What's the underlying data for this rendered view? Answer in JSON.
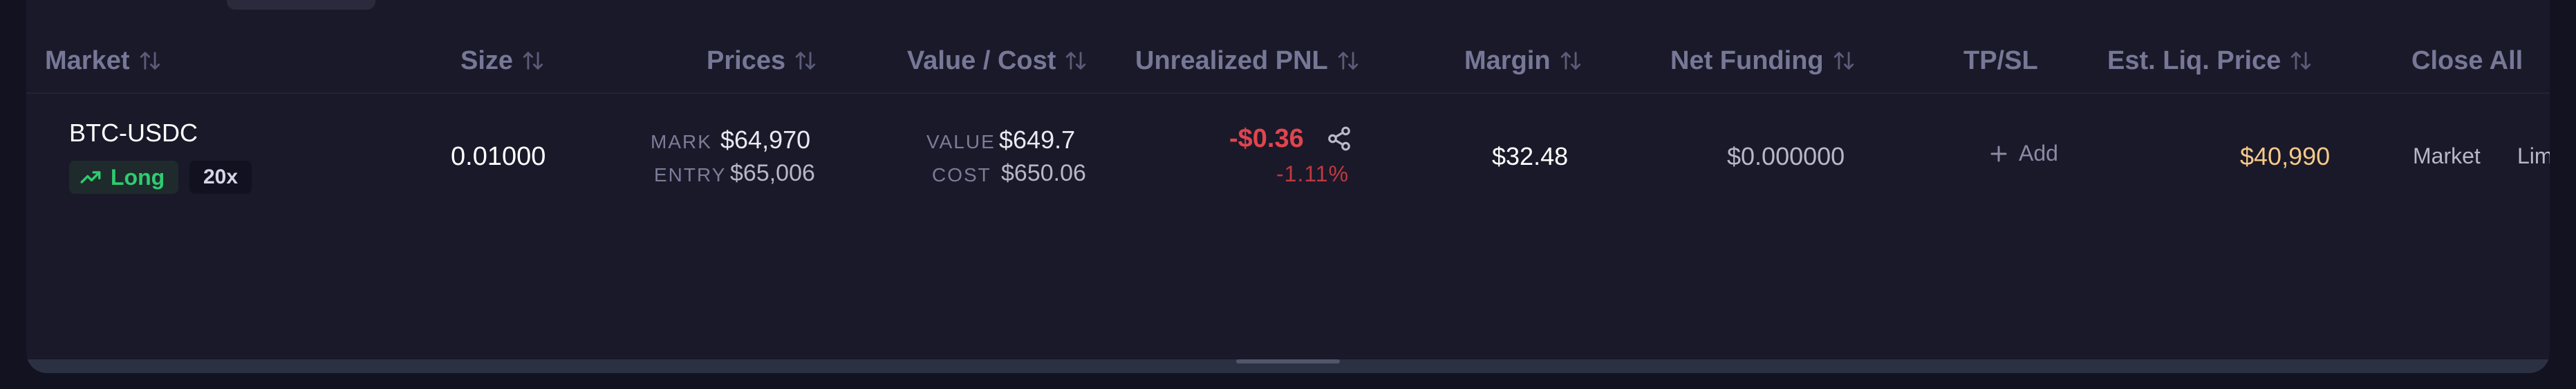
{
  "headers": {
    "market": "Market",
    "size": "Size",
    "prices": "Prices",
    "value_cost": "Value / Cost",
    "unrealized_pnl": "Unrealized PNL",
    "margin": "Margin",
    "net_funding": "Net Funding",
    "tpsl": "TP/SL",
    "est_liq_price": "Est. Liq. Price",
    "close_all": "Close All"
  },
  "position": {
    "market": "BTC-USDC",
    "side": "Long",
    "side_icon": "trend-up-icon",
    "leverage": "20x",
    "size": "0.01000",
    "mark_label": "MARK",
    "mark_price": "$64,970",
    "entry_label": "ENTRY",
    "entry_price": "$65,006",
    "value_label": "VALUE",
    "value": "$649.7",
    "cost_label": "COST",
    "cost": "$650.06",
    "pnl": "-$0.36",
    "pnl_pct": "-1.11%",
    "margin": "$32.48",
    "net_funding": "$0.000000",
    "tpsl_add": "Add",
    "liq_price": "$40,990",
    "close_market": "Market",
    "close_limit": "Limit"
  },
  "colors": {
    "positive": "#2ecc71",
    "negative": "#e0454e",
    "liq": "#f5c98a"
  }
}
